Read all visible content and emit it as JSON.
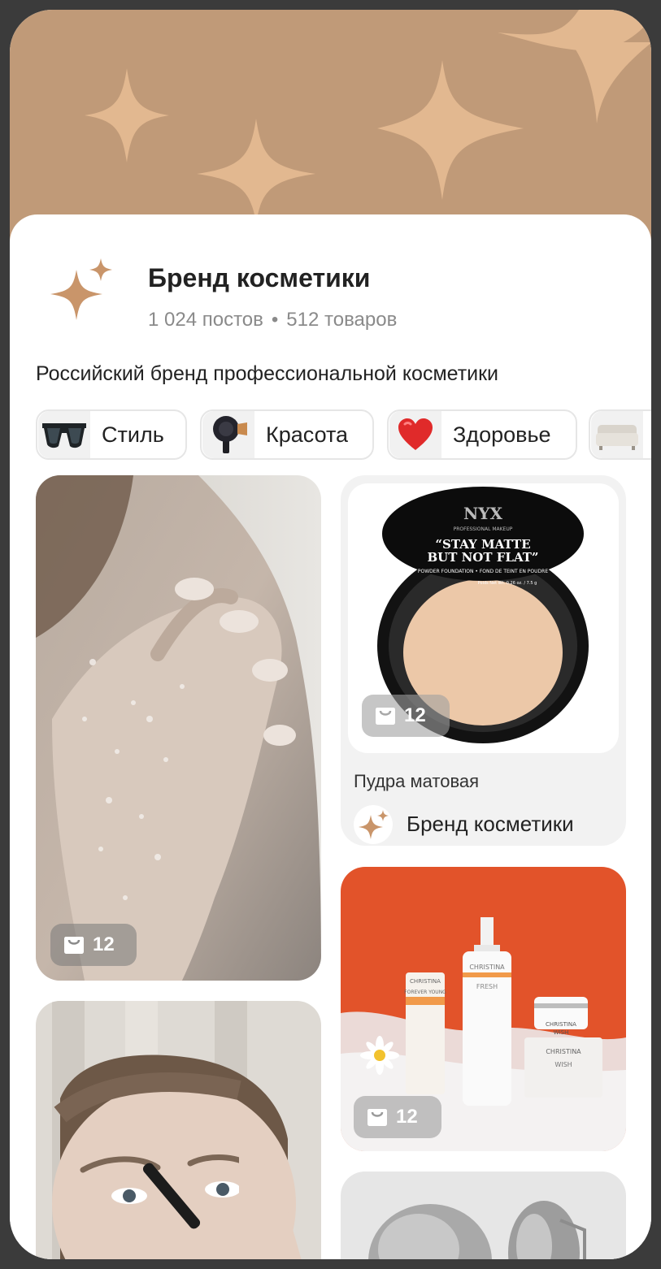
{
  "brand": {
    "name": "Бренд косметики",
    "posts": "1 024 постов",
    "separator": "•",
    "goods": "512 товаров",
    "description": "Российский бренд профессиональной косметики"
  },
  "chips": [
    {
      "label": "Стиль",
      "icon": "sunglasses-icon"
    },
    {
      "label": "Красота",
      "icon": "hair-dryer-icon"
    },
    {
      "label": "Здоровье",
      "icon": "heart-icon"
    },
    {
      "label": "",
      "icon": "sofa-icon"
    }
  ],
  "feed": {
    "post1": {
      "count": "12"
    },
    "post2": {
      "count": ""
    },
    "product1": {
      "count": "12",
      "title": "Пудра матовая",
      "brand": "Бренд косметики",
      "package_lines": [
        "NYX",
        "PROFESSIONAL MAKEUP",
        "“STAY MATTE",
        "BUT NOT FLAT”",
        "POWDER FOUNDATION • FOND DE TEINT EN POUDRE",
        "Poids Net Wt. 0.26 oz. / 7.5 g"
      ]
    },
    "product2": {
      "count": "12",
      "package_lines": [
        "CHRISTINA",
        "FOREVER YOUNG",
        "CHRISTINA",
        "FRESH",
        "CHRISTINA",
        "WISH",
        "CHRISTINA",
        "WISH"
      ]
    }
  },
  "colors": {
    "cover": "#c09a78",
    "star": "#e2b890",
    "accent": "#c9956a",
    "product2_bg": "#e2532a"
  }
}
